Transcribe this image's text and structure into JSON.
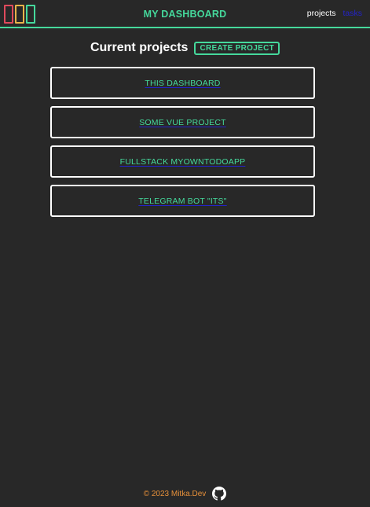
{
  "header": {
    "title": "MY DASHBOARD",
    "nav": [
      {
        "label": "projects",
        "active": true
      },
      {
        "label": "tasks",
        "active": false
      }
    ],
    "logo_colors": [
      "#e04a5c",
      "#e8b34a",
      "#45d99c"
    ]
  },
  "main": {
    "section_title": "Current projects",
    "create_button_label": "CREATE PROJECT",
    "projects": [
      {
        "name": "THIS DASHBOARD"
      },
      {
        "name": "SOME VUE PROJECT"
      },
      {
        "name": "FULLSTACK MYOWNTODOAPP"
      },
      {
        "name": "TELEGRAM BOT \"ITS\""
      }
    ]
  },
  "footer": {
    "text": "© 2023 Mitka.Dev",
    "icon": "github-icon"
  },
  "colors": {
    "background": "#282828",
    "accent": "#45d99c",
    "footer_text": "#e8913a",
    "link_inactive": "#2323c8"
  }
}
